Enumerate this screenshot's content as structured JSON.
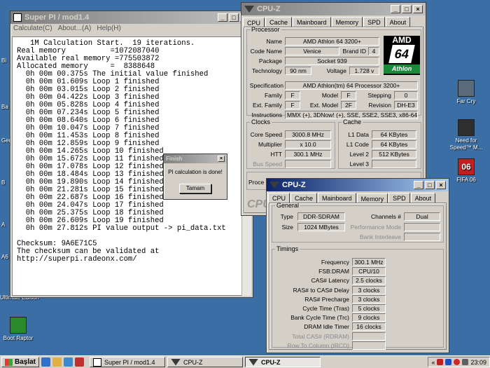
{
  "desktop": {
    "icons": [
      {
        "label": "Far Cry",
        "color": "#5a6a78"
      },
      {
        "label": "Need for Speed™ M...",
        "color": "#2e2e2e"
      },
      {
        "label": "FIFA 06",
        "color": "#c02020"
      },
      {
        "label": "Ultimate Edition",
        "color": "#4a6ad0"
      },
      {
        "label": "Boot Raptor",
        "color": "#2a8a2a"
      }
    ],
    "edge_labels": [
      "Bi",
      "Ba",
      "Ger",
      "B",
      "A",
      "A6"
    ]
  },
  "superpi": {
    "title": "Super PI / mod1.4",
    "menu": [
      "Calculate(C)",
      "About...(A)",
      "Help(H)"
    ],
    "lines": [
      "   1M Calculation Start.  19 iterations.",
      "Real memory          =1072087040",
      "Available real memory =775503872",
      "Allocated memory     =  8388648",
      "  0h 00m 00.375s The initial value finished",
      "  0h 00m 01.609s Loop 1 finished",
      "  0h 00m 03.015s Loop 2 finished",
      "  0h 00m 04.422s Loop 3 finished",
      "  0h 00m 05.828s Loop 4 finished",
      "  0h 00m 07.234s Loop 5 finished",
      "  0h 00m 08.640s Loop 6 finished",
      "  0h 00m 10.047s Loop 7 finished",
      "  0h 00m 11.453s Loop 8 finished",
      "  0h 00m 12.859s Loop 9 finished",
      "  0h 00m 14.265s Loop 10 finished",
      "  0h 00m 15.672s Loop 11 finished",
      "  0h 00m 17.078s Loop 12 finished",
      "  0h 00m 18.484s Loop 13 finished",
      "  0h 00m 19.890s Loop 14 finished",
      "  0h 00m 21.281s Loop 15 finished",
      "  0h 00m 22.687s Loop 16 finished",
      "  0h 00m 24.047s Loop 17 finished",
      "  0h 00m 25.375s Loop 18 finished",
      "  0h 00m 26.609s Loop 19 finished",
      "  0h 00m 27.812s PI value output -> pi_data.txt",
      "",
      "Checksum: 9A6E71C5",
      "The checksum can be validated at",
      "http://superpi.radeonx.com/"
    ]
  },
  "finish_dialog": {
    "title": "Finish",
    "message": "PI calculation is done!",
    "button": "Tamam"
  },
  "cpuz_back": {
    "title": "CPU-Z",
    "tabs": [
      "CPU",
      "Cache",
      "Mainboard",
      "Memory",
      "SPD",
      "About"
    ],
    "selected_tab": "CPU",
    "processor_legend": "Processor",
    "name_label": "Name",
    "name": "AMD Athlon 64 3200+",
    "codename_label": "Code Name",
    "codename": "Venice",
    "brandid_label": "Brand ID",
    "brandid": "4",
    "package_label": "Package",
    "package": "Socket 939",
    "technology_label": "Technology",
    "technology": "90 nm",
    "voltage_label": "Voltage",
    "voltage": "1.728 v",
    "spec_label": "Specification",
    "spec": "AMD Athlon(tm) 64 Processor 3200+",
    "family_label": "Family",
    "family": "F",
    "model_label": "Model",
    "model": "F",
    "stepping_label": "Stepping",
    "stepping": "0",
    "extfamily_label": "Ext. Family",
    "extfamily": "F",
    "extmodel_label": "Ext. Model",
    "extmodel": "2F",
    "revision_label": "Revision",
    "revision": "DH-E3",
    "instr_label": "Instructions",
    "instructions": "MMX (+), 3DNow! (+), SSE, SSE2, SSE3, x86-64",
    "clocks_legend": "Clocks",
    "corespeed_label": "Core Speed",
    "corespeed": "3000.8 MHz",
    "multiplier_label": "Multiplier",
    "multiplier": "x 10.0",
    "htt_label": "HTT",
    "htt": "300.1 MHz",
    "busspeed_label": "Bus Speed",
    "cache_legend": "Cache",
    "l1data_label": "L1 Data",
    "l1data": "64 KBytes",
    "l1code_label": "L1 Code",
    "l1code": "64 KBytes",
    "level2_label": "Level 2",
    "level2": "512 KBytes",
    "level3_label": "Level 3",
    "proc_label": "Proce",
    "logo_text": "CPU",
    "amd_logo": {
      "brand": "AMD",
      "mark": "64",
      "sub": "Athlon"
    }
  },
  "cpuz_front": {
    "title": "CPU-Z",
    "tabs": [
      "CPU",
      "Cache",
      "Mainboard",
      "Memory",
      "SPD",
      "About"
    ],
    "selected_tab": "Memory",
    "general_legend": "General",
    "type_label": "Type",
    "type": "DDR-SDRAM",
    "size_label": "Size",
    "size": "1024 MBytes",
    "channels_label": "Channels #",
    "channels": "Dual",
    "perfmode_label": "Performance Mode",
    "bankinter_label": "Bank Interleave",
    "timings_legend": "Timings",
    "timings": [
      {
        "label": "Frequency",
        "value": "300.1 MHz"
      },
      {
        "label": "FSB:DRAM",
        "value": "CPU/10"
      },
      {
        "label": "CAS# Latency",
        "value": "2.5 clocks"
      },
      {
        "label": "RAS# to CAS# Delay",
        "value": "3 clocks"
      },
      {
        "label": "RAS# Precharge",
        "value": "3 clocks"
      },
      {
        "label": "Cycle Time (Tras)",
        "value": "5 clocks"
      },
      {
        "label": "Bank Cycle Time (Trc)",
        "value": "9 clocks"
      },
      {
        "label": "DRAM Idle Timer",
        "value": "16 clocks"
      },
      {
        "label": "Total CAS# (RDRAM)",
        "value": ""
      },
      {
        "label": "Row To Column (tRCD)",
        "value": ""
      }
    ]
  },
  "taskbar": {
    "start": "Başlat",
    "items": [
      "Super PI / mod1.4",
      "CPU-Z",
      "CPU-Z"
    ],
    "clock": "23:09"
  }
}
